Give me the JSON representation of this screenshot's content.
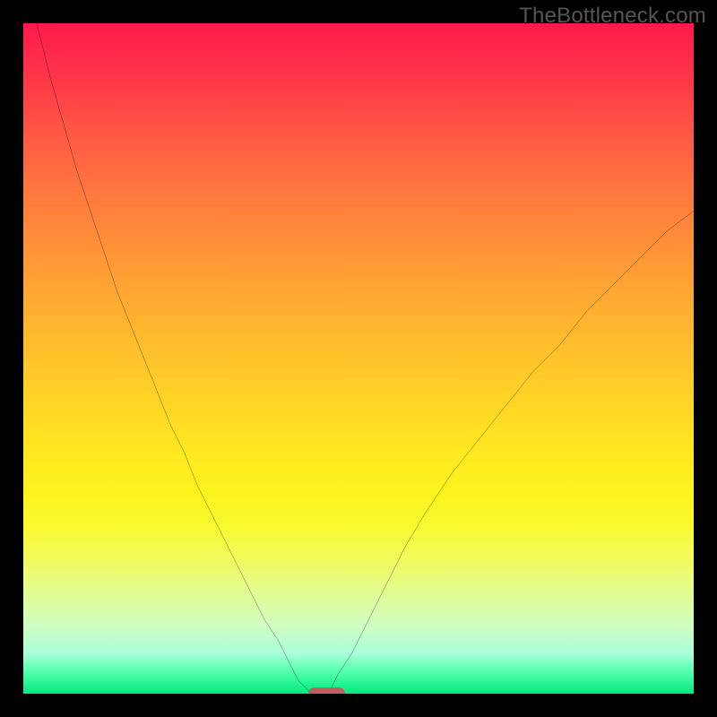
{
  "watermark": "TheBottleneck.com",
  "colors": {
    "frame": "#000000",
    "curve": "#000000",
    "marker": "#c1605f"
  },
  "chart_data": {
    "type": "line",
    "title": "",
    "xlabel": "",
    "ylabel": "",
    "xlim": [
      0,
      100
    ],
    "ylim": [
      0,
      100
    ],
    "x": [
      0,
      2,
      4,
      6,
      8,
      10,
      12,
      14,
      16,
      18,
      20,
      22,
      24,
      26,
      28,
      30,
      32,
      34,
      36,
      38,
      40,
      41,
      42,
      43,
      44,
      45,
      46,
      47,
      49,
      51,
      54,
      57,
      60,
      64,
      68,
      72,
      76,
      80,
      84,
      88,
      92,
      96,
      100
    ],
    "values": [
      108,
      100,
      92,
      85,
      78,
      72,
      66,
      60,
      55,
      50,
      45,
      40,
      36,
      31,
      27,
      23,
      19,
      15,
      11,
      8,
      4,
      2,
      1,
      0,
      0,
      0,
      1,
      3,
      6,
      10,
      16,
      22,
      27,
      33,
      38,
      43,
      48,
      52,
      57,
      61,
      65,
      69,
      72
    ],
    "marker": {
      "x_start": 42.5,
      "x_end": 48,
      "y": 0
    },
    "annotations": [],
    "legend": []
  }
}
